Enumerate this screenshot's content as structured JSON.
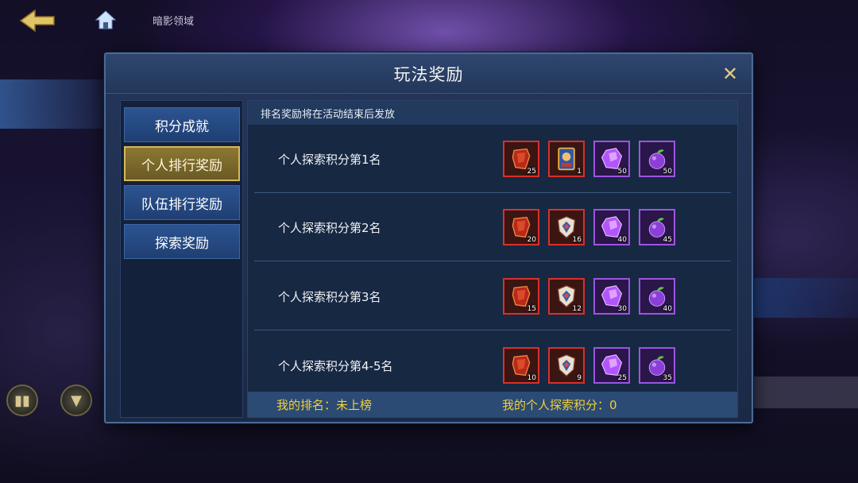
{
  "background": {
    "top_label": "暗影领域"
  },
  "dialog": {
    "title": "玩法奖励",
    "tabs": [
      {
        "label": "积分成就",
        "active": false
      },
      {
        "label": "个人排行奖励",
        "active": true
      },
      {
        "label": "队伍排行奖励",
        "active": false
      },
      {
        "label": "探索奖励",
        "active": false
      }
    ],
    "notice": "排名奖励将在活动结束后发放",
    "rows": [
      {
        "label": "个人探索积分第1名",
        "items": [
          {
            "icon": "red-crystal-icon",
            "quality": "red",
            "qty": "25"
          },
          {
            "icon": "card-icon",
            "quality": "red",
            "qty": "1"
          },
          {
            "icon": "purple-gem-icon",
            "quality": "purple",
            "qty": "50"
          },
          {
            "icon": "purple-fruit-icon",
            "quality": "purple",
            "qty": "50"
          }
        ]
      },
      {
        "label": "个人探索积分第2名",
        "items": [
          {
            "icon": "red-crystal-icon",
            "quality": "red",
            "qty": "20"
          },
          {
            "icon": "shield-crest-icon",
            "quality": "red",
            "qty": "16"
          },
          {
            "icon": "purple-gem-icon",
            "quality": "purple",
            "qty": "40"
          },
          {
            "icon": "purple-fruit-icon",
            "quality": "purple",
            "qty": "45"
          }
        ]
      },
      {
        "label": "个人探索积分第3名",
        "items": [
          {
            "icon": "red-crystal-icon",
            "quality": "red",
            "qty": "15"
          },
          {
            "icon": "shield-crest-icon",
            "quality": "red",
            "qty": "12"
          },
          {
            "icon": "purple-gem-icon",
            "quality": "purple",
            "qty": "30"
          },
          {
            "icon": "purple-fruit-icon",
            "quality": "purple",
            "qty": "40"
          }
        ]
      },
      {
        "label": "个人探索积分第4-5名",
        "items": [
          {
            "icon": "red-crystal-icon",
            "quality": "red",
            "qty": "10"
          },
          {
            "icon": "shield-crest-icon",
            "quality": "red",
            "qty": "9"
          },
          {
            "icon": "purple-gem-icon",
            "quality": "purple",
            "qty": "25"
          },
          {
            "icon": "purple-fruit-icon",
            "quality": "purple",
            "qty": "35"
          }
        ]
      }
    ],
    "footer": {
      "my_rank": "我的排名：未上榜",
      "my_score": "我的个人探索积分：0"
    }
  },
  "colors": {
    "accent_gold": "#f2cf3c",
    "quality_red": "#d8302a",
    "quality_purple": "#9b55e0"
  }
}
